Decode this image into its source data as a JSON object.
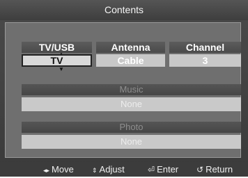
{
  "title": "Contents",
  "columns": [
    {
      "header": "TV/USB",
      "value": "TV"
    },
    {
      "header": "Antenna",
      "value": "Cable"
    },
    {
      "header": "Channel",
      "value": "3"
    }
  ],
  "sections": [
    {
      "header": "Music",
      "value": "None"
    },
    {
      "header": "Photo",
      "value": "None"
    }
  ],
  "footer": {
    "move": "Move",
    "adjust": "Adjust",
    "enter": "Enter",
    "return": "Return"
  },
  "icons": {
    "move": "left-right-arrows-icon",
    "adjust": "up-down-arrows-icon",
    "enter": "enter-icon",
    "return": "return-icon",
    "up": "chevron-up-icon",
    "down": "chevron-down-icon"
  },
  "colors": {
    "background": "#3c3c3c",
    "panel": "#6f6f6f",
    "selected_border": "#222222"
  }
}
